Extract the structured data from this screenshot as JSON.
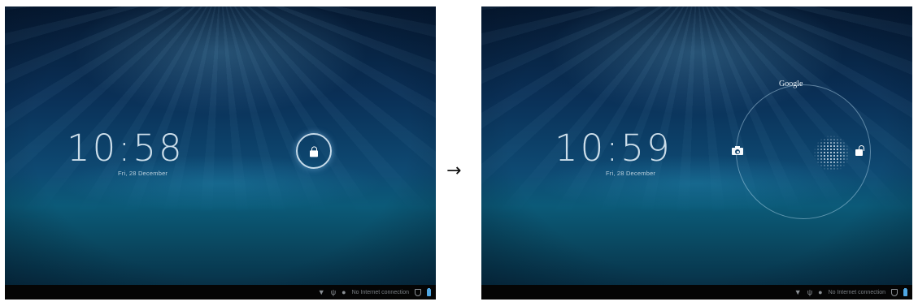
{
  "screens": [
    {
      "clock": "10:58",
      "date": "Fri, 28 December",
      "statusbar": {
        "text": "No Internet connection",
        "icons": [
          "wifi-icon",
          "usb-icon",
          "android-icon",
          "shield-icon",
          "battery-icon"
        ]
      }
    },
    {
      "clock": "10:59",
      "date": "Fri, 28 December",
      "google_label": "Google",
      "statusbar": {
        "text": "No Internet connection",
        "icons": [
          "wifi-icon",
          "usb-icon",
          "android-icon",
          "shield-icon",
          "battery-icon"
        ]
      }
    }
  ],
  "transition_arrow": "→",
  "colors": {
    "accent_battery": "#4fa7e3",
    "statusbar_bg": "#050505"
  }
}
